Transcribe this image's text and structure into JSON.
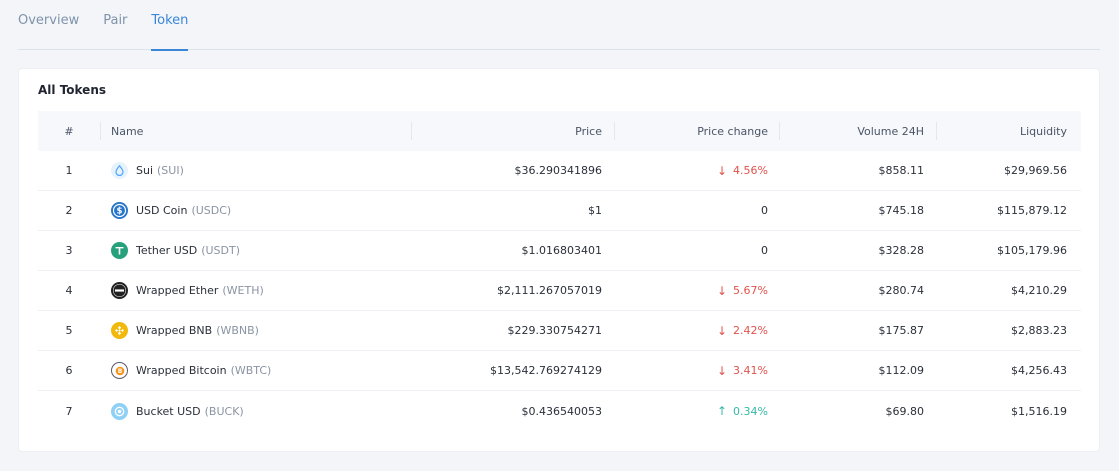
{
  "tabs": [
    {
      "label": "Overview"
    },
    {
      "label": "Pair"
    },
    {
      "label": "Token"
    }
  ],
  "card": {
    "title": "All Tokens",
    "headers": {
      "index": "#",
      "name": "Name",
      "price": "Price",
      "change": "Price change",
      "volume": "Volume 24H",
      "liquidity": "Liquidity"
    }
  },
  "rows": [
    {
      "index": "1",
      "name": "Sui",
      "symbol": "(SUI)",
      "price": "$36.290341896",
      "change": "4.56%",
      "volume": "$858.11",
      "liquidity": "$29,969.56"
    },
    {
      "index": "2",
      "name": "USD Coin",
      "symbol": "(USDC)",
      "price": "$1",
      "change": "0",
      "volume": "$745.18",
      "liquidity": "$115,879.12"
    },
    {
      "index": "3",
      "name": "Tether USD",
      "symbol": "(USDT)",
      "price": "$1.016803401",
      "change": "0",
      "volume": "$328.28",
      "liquidity": "$105,179.96"
    },
    {
      "index": "4",
      "name": "Wrapped Ether",
      "symbol": "(WETH)",
      "price": "$2,111.267057019",
      "change": "5.67%",
      "volume": "$280.74",
      "liquidity": "$4,210.29"
    },
    {
      "index": "5",
      "name": "Wrapped BNB",
      "symbol": "(WBNB)",
      "price": "$229.330754271",
      "change": "2.42%",
      "volume": "$175.87",
      "liquidity": "$2,883.23"
    },
    {
      "index": "6",
      "name": "Wrapped Bitcoin",
      "symbol": "(WBTC)",
      "price": "$13,542.769274129",
      "change": "3.41%",
      "volume": "$112.09",
      "liquidity": "$4,256.43"
    },
    {
      "index": "7",
      "name": "Bucket USD",
      "symbol": "(BUCK)",
      "price": "$0.436540053",
      "change": "0.34%",
      "volume": "$69.80",
      "liquidity": "$1,516.19"
    }
  ],
  "icons": {
    "down_arrow": "arrow-down-icon",
    "up_arrow": "arrow-up-icon"
  },
  "colors": {
    "accent": "#3b86d6",
    "negative": "#e2524c",
    "positive": "#36b8a8"
  }
}
